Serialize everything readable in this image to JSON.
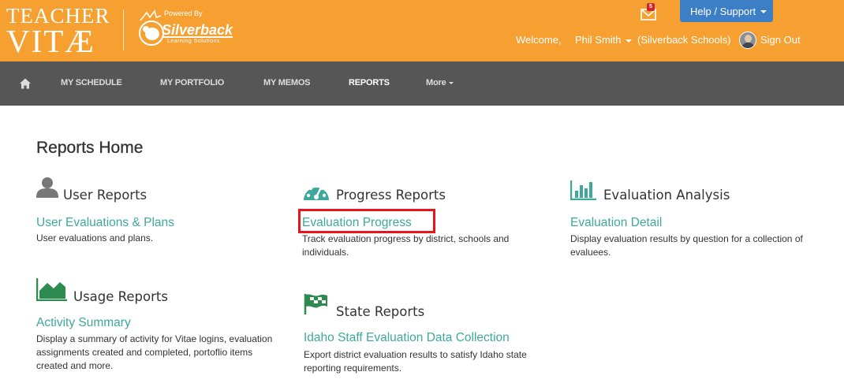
{
  "header": {
    "logo_line1": "TEACHER",
    "logo_line2": "VITÆ",
    "powered_by": "Powered By",
    "powered_name": "Silverback",
    "powered_sub": "Learning Solutions",
    "mail_badge": "5",
    "help_label": "Help / Support",
    "welcome": "Welcome,",
    "user_name": "Phil Smith",
    "school": "(Silverback Schools)",
    "signout": "Sign Out",
    "colors": {
      "bar": "#F6A032",
      "help": "#3C7FC6",
      "badge": "#D0242B"
    }
  },
  "nav": {
    "home_icon": "home-icon",
    "items": [
      {
        "label": "MY SCHEDULE"
      },
      {
        "label": "MY PORTFOLIO"
      },
      {
        "label": "MY MEMOS"
      },
      {
        "label": "REPORTS"
      },
      {
        "label": "More"
      }
    ],
    "active": "REPORTS",
    "color": "#565656"
  },
  "main": {
    "title": "Reports Home",
    "link_color": "#3EA89B",
    "sections": [
      {
        "icon": "user-icon",
        "title": "User Reports",
        "link": "User Evaluations & Plans",
        "description": "User evaluations and plans."
      },
      {
        "icon": "dashboard-icon",
        "title": "Progress Reports",
        "link": "Evaluation Progress",
        "description": "Track evaluation progress by district, schools and individuals."
      },
      {
        "icon": "bar-chart-icon",
        "title": "Evaluation Analysis",
        "link": "Evaluation Detail",
        "description": "Display evaluation results by question for a collection of evaluees."
      },
      {
        "icon": "area-chart-icon",
        "title": "Usage Reports",
        "link": "Activity Summary",
        "description": "Display a summary of activity for Vitae logins, evaluation assignments created and completed, portoflio items created and more."
      },
      {
        "icon": "flag-icon",
        "title": "State Reports",
        "link": "Idaho Staff Evaluation Data Collection",
        "description": "Export district evaluation results to satisfy Idaho state reporting requirements."
      }
    ]
  }
}
